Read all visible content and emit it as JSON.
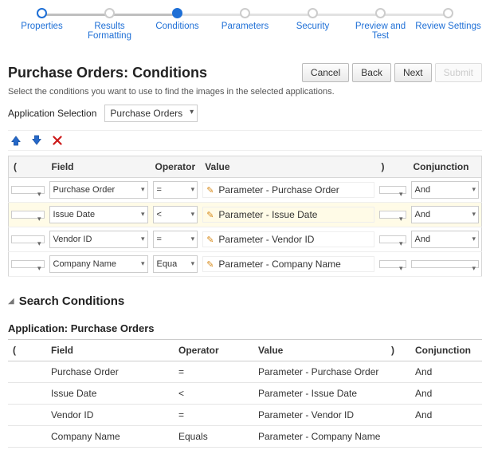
{
  "stepper": [
    {
      "label": "Properties",
      "state": "current"
    },
    {
      "label": "Results Formatting",
      "state": "idle"
    },
    {
      "label": "Conditions",
      "state": "active"
    },
    {
      "label": "Parameters",
      "state": "idle"
    },
    {
      "label": "Security",
      "state": "idle"
    },
    {
      "label": "Preview and Test",
      "state": "idle"
    },
    {
      "label": "Review Settings",
      "state": "idle"
    }
  ],
  "title": "Purchase Orders: Conditions",
  "actions": {
    "cancel": "Cancel",
    "back": "Back",
    "next": "Next",
    "submit": "Submit"
  },
  "subtext": "Select the conditions you want to use to find the images in the selected applications.",
  "app_selection": {
    "label": "Application Selection",
    "value": "Purchase Orders"
  },
  "grid": {
    "headers": {
      "open": "(",
      "field": "Field",
      "operator": "Operator",
      "value": "Value",
      "close": ")",
      "conj": "Conjunction"
    },
    "rows": [
      {
        "open": "",
        "field": "Purchase Order",
        "op": "=",
        "value": "Parameter - Purchase Order",
        "close": "",
        "conj": "And",
        "highl": false
      },
      {
        "open": "",
        "field": "Issue Date",
        "op": "<",
        "value": "Parameter - Issue Date",
        "close": "",
        "conj": "And",
        "highl": true
      },
      {
        "open": "",
        "field": "Vendor ID",
        "op": "=",
        "value": "Parameter - Vendor ID",
        "close": "",
        "conj": "And",
        "highl": false
      },
      {
        "open": "",
        "field": "Company Name",
        "op": "Equa",
        "value": "Parameter - Company Name",
        "close": "",
        "conj": "",
        "highl": false
      }
    ]
  },
  "search_section": {
    "heading": "Search Conditions",
    "subheading": "Application: Purchase Orders",
    "headers": {
      "open": "(",
      "field": "Field",
      "operator": "Operator",
      "value": "Value",
      "close": ")",
      "conj": "Conjunction"
    },
    "rows": [
      {
        "open": "",
        "field": "Purchase Order",
        "op": "=",
        "value": "Parameter - Purchase Order",
        "close": "",
        "conj": "And"
      },
      {
        "open": "",
        "field": "Issue Date",
        "op": "<",
        "value": "Parameter - Issue Date",
        "close": "",
        "conj": "And"
      },
      {
        "open": "",
        "field": "Vendor ID",
        "op": "=",
        "value": "Parameter - Vendor ID",
        "close": "",
        "conj": "And"
      },
      {
        "open": "",
        "field": "Company Name",
        "op": "Equals",
        "value": "Parameter - Company Name",
        "close": "",
        "conj": ""
      }
    ]
  }
}
